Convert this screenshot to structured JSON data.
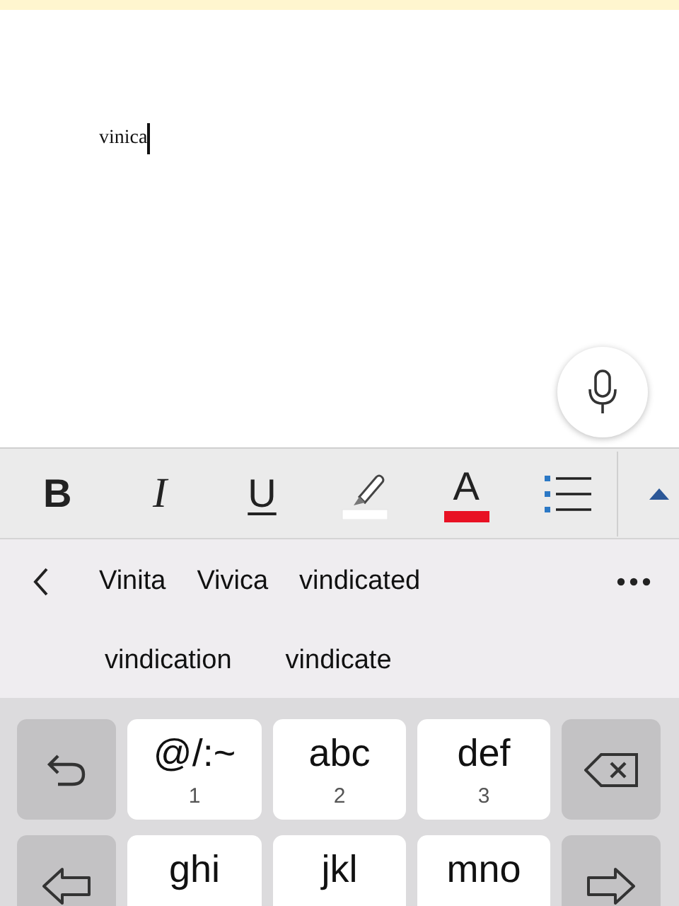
{
  "document": {
    "text": "vinica"
  },
  "toolbar": {
    "buttons": [
      {
        "kind": "bold",
        "label": "B"
      },
      {
        "kind": "italic",
        "label": "I"
      },
      {
        "kind": "underline",
        "label": "U"
      },
      {
        "kind": "highlight",
        "color": "#ffffff"
      },
      {
        "kind": "font-color",
        "label": "A",
        "color": "#e81123"
      },
      {
        "kind": "list"
      }
    ]
  },
  "suggestions": {
    "words": [
      "Vinita",
      "Vivica",
      "vindicated",
      "vindication",
      "vindicate"
    ]
  },
  "keyboard": {
    "rows": [
      [
        {
          "kind": "undo"
        },
        {
          "kind": "letters",
          "label": "@/:~",
          "digit": "1"
        },
        {
          "kind": "letters",
          "label": "abc",
          "digit": "2"
        },
        {
          "kind": "letters",
          "label": "def",
          "digit": "3"
        },
        {
          "kind": "backspace"
        }
      ],
      [
        {
          "kind": "left"
        },
        {
          "kind": "letters",
          "label": "ghi"
        },
        {
          "kind": "letters",
          "label": "jkl"
        },
        {
          "kind": "letters",
          "label": "mno"
        },
        {
          "kind": "right"
        }
      ]
    ]
  }
}
